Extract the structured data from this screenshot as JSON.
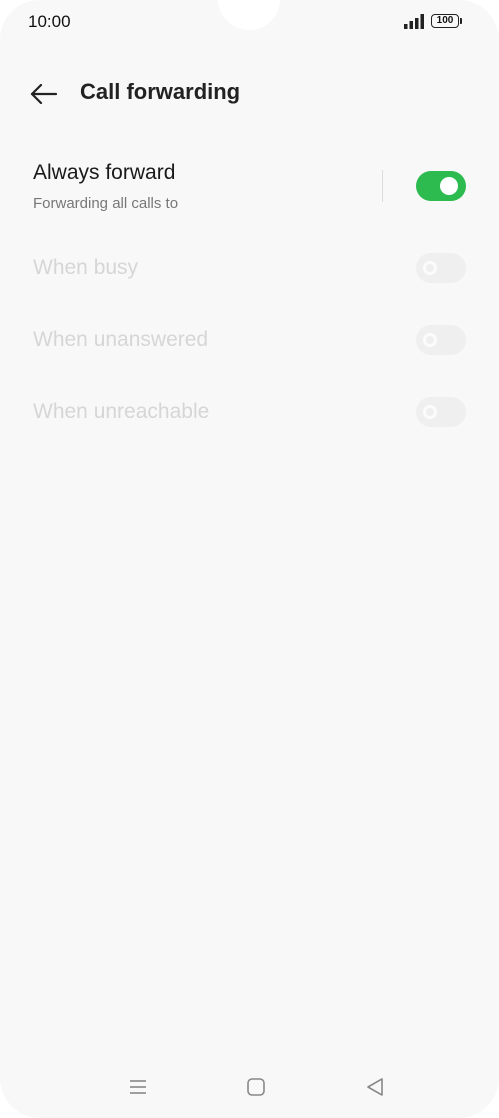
{
  "status_bar": {
    "time": "10:00",
    "battery": "100",
    "signal_icon": "signal-icon"
  },
  "header": {
    "title": "Call forwarding",
    "back_icon": "back-arrow-icon"
  },
  "settings": [
    {
      "label": "Always forward",
      "subtitle": "Forwarding all calls to",
      "enabled": true,
      "toggle": "on"
    },
    {
      "label": "When busy",
      "enabled": false,
      "toggle": "off"
    },
    {
      "label": "When unanswered",
      "enabled": false,
      "toggle": "off"
    },
    {
      "label": "When unreachable",
      "enabled": false,
      "toggle": "off"
    }
  ],
  "nav_bar": {
    "items": [
      "menu-icon",
      "home-icon",
      "back-icon"
    ]
  },
  "colors": {
    "toggle_on": "#2dba4e",
    "background": "#f8f8f8"
  }
}
